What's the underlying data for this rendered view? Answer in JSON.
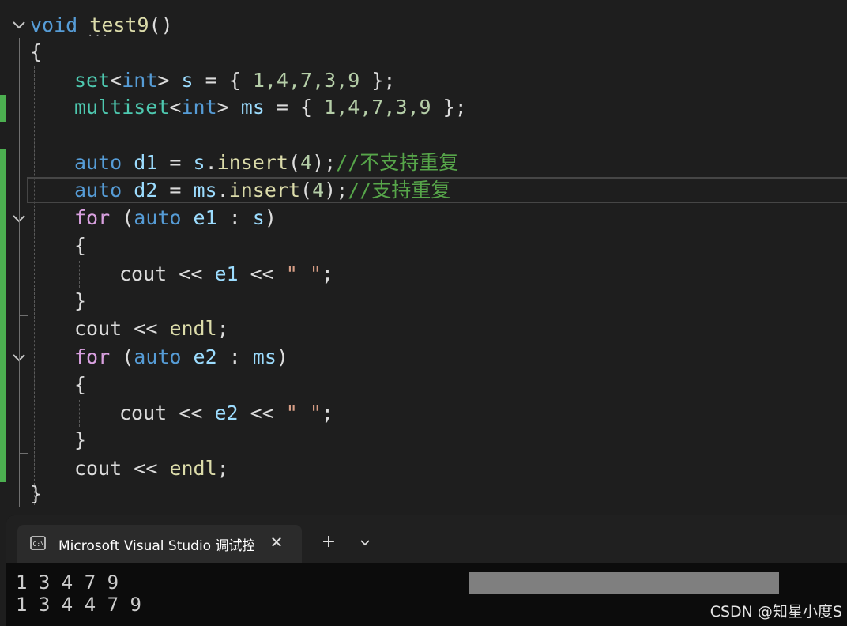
{
  "editor": {
    "function_return_type": "void",
    "function_name": "test9",
    "function_parens": "()",
    "lines": {
      "open_brace": "{",
      "l1_set": "set",
      "l1_tpl": "<int>",
      "l1_rest": " s = { ",
      "l1_vals": "1,4,7,3,9",
      "l1_end": " };",
      "l2_set": "multiset",
      "l2_tpl": "<int>",
      "l2_rest": " ms = { ",
      "l2_vals": "1,4,7,3,9",
      "l2_end": " };",
      "l3_auto": "auto",
      "l3_var": " d1",
      "l3_eq": " = ",
      "l3_obj": "s",
      "l3_dot": ".",
      "l3_fn": "insert",
      "l3_open": "(",
      "l3_num": "4",
      "l3_close": ");",
      "l3_comment": "//不支持重复",
      "l4_auto": "auto",
      "l4_var": " d2",
      "l4_eq": " = ",
      "l4_obj": "ms",
      "l4_dot": ".",
      "l4_fn": "insert",
      "l4_open": "(",
      "l4_num": "4",
      "l4_close": ");",
      "l4_comment": "//支持重复",
      "for1_kw": "for",
      "for1_open": " (",
      "for1_auto": "auto",
      "for1_var": " e1",
      "for1_colon": " : ",
      "for1_src": "s",
      "for1_close": ")",
      "for1_lbrace": "{",
      "for1_cout": "cout",
      "for1_op1": " << ",
      "for1_e": "e1",
      "for1_op2": " << ",
      "for1_str": "\" \"",
      "for1_semi": ";",
      "for1_rbrace": "}",
      "endl1_cout": "cout",
      "endl1_op": " << ",
      "endl1_endl": "endl",
      "endl1_semi": ";",
      "for2_kw": "for",
      "for2_open": " (",
      "for2_auto": "auto",
      "for2_var": " e2",
      "for2_colon": " : ",
      "for2_src": "ms",
      "for2_close": ")",
      "for2_lbrace": "{",
      "for2_cout": "cout",
      "for2_op1": " << ",
      "for2_e": "e2",
      "for2_op2": " << ",
      "for2_str": "\" \"",
      "for2_semi": ";",
      "for2_rbrace": "}",
      "endl2_cout": "cout",
      "endl2_op": " << ",
      "endl2_endl": "endl",
      "endl2_semi": ";",
      "close_brace": "}"
    },
    "change_bar_color": "#4caf50"
  },
  "terminal": {
    "tab_title": "Microsoft Visual Studio 调试控制台",
    "tab_icon": "console-icon",
    "close_icon": "close-icon",
    "new_tab_icon": "plus-icon",
    "dropdown_icon": "chevron-down-icon",
    "output": [
      "1 3 4 7 9",
      "1 3 4 4 7 9"
    ]
  },
  "watermark": "CSDN @知星小度S"
}
